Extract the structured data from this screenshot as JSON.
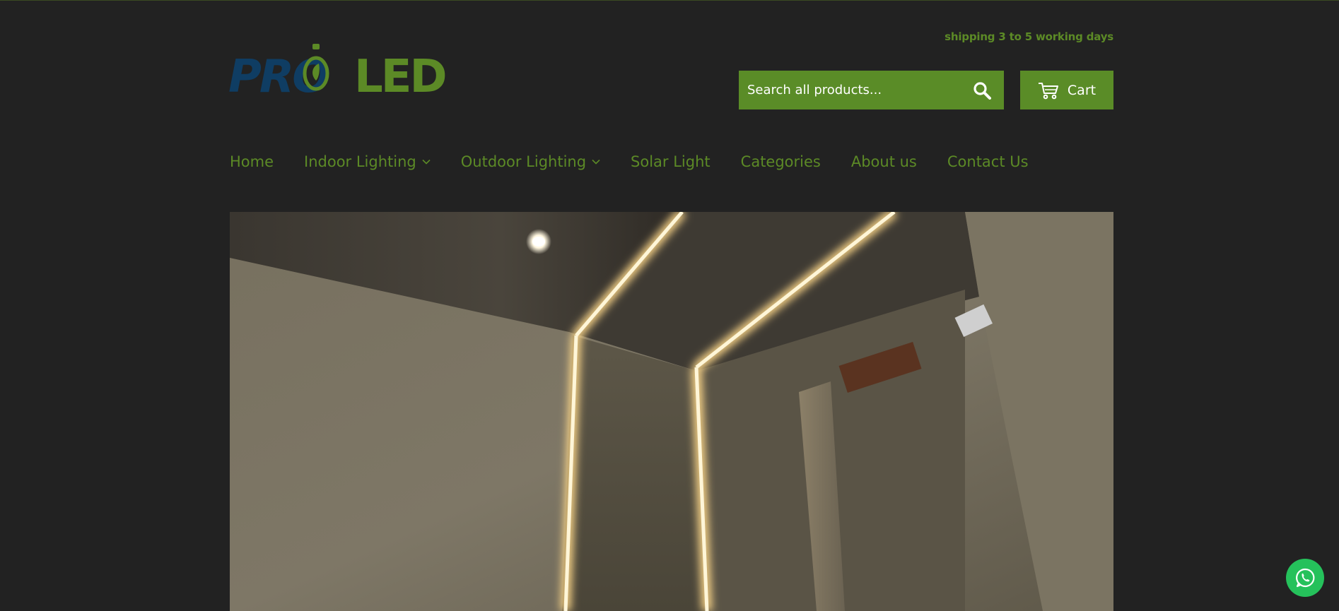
{
  "brand": {
    "logo_part1": "PRO",
    "logo_part2": "LED",
    "color_blue": "#0f3d63",
    "color_green": "#5c8a26"
  },
  "header": {
    "shipping_note": "shipping 3 to 5 working days",
    "search_placeholder": "Search all products...",
    "cart_label": "Cart"
  },
  "nav": {
    "items": [
      {
        "label": "Home",
        "has_dropdown": false
      },
      {
        "label": "Indoor Lighting",
        "has_dropdown": true
      },
      {
        "label": "Outdoor Lighting",
        "has_dropdown": true
      },
      {
        "label": "Solar Light",
        "has_dropdown": false
      },
      {
        "label": "Categories",
        "has_dropdown": false
      },
      {
        "label": "About us",
        "has_dropdown": false
      },
      {
        "label": "Contact Us",
        "has_dropdown": false
      }
    ]
  },
  "colors": {
    "background": "#222222",
    "accent": "#5a8c27",
    "whatsapp": "#25c15b"
  },
  "icons": {
    "search": "search-icon",
    "cart": "cart-icon",
    "dropdown": "chevron-down-icon",
    "chat": "whatsapp-icon"
  }
}
